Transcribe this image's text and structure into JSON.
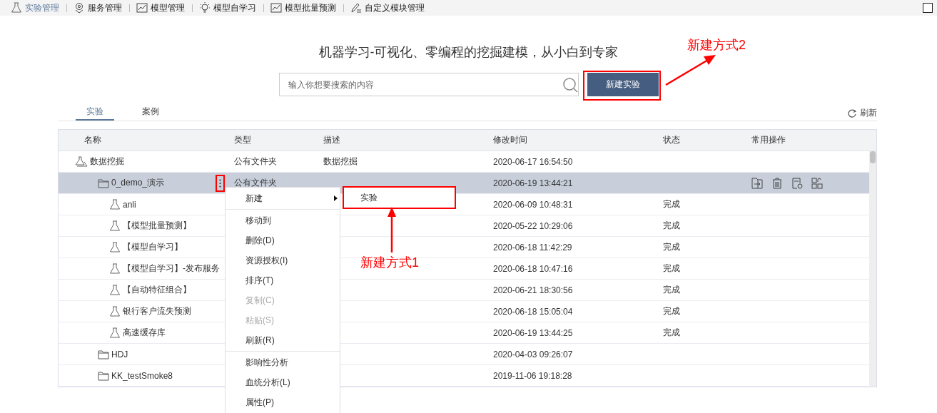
{
  "nav": [
    {
      "label": "实验管理",
      "selected": true
    },
    {
      "label": "服务管理",
      "selected": false
    },
    {
      "label": "模型管理",
      "selected": false
    },
    {
      "label": "模型自学习",
      "selected": false
    },
    {
      "label": "模型批量预测",
      "selected": false
    },
    {
      "label": "自定义模块管理",
      "selected": false
    }
  ],
  "headline": "机器学习-可视化、零编程的挖掘建模，从小白到专家",
  "search": {
    "placeholder": "输入你想要搜索的内容"
  },
  "new_button": "新建实验",
  "tabs": [
    {
      "label": "实验",
      "selected": true
    },
    {
      "label": "案例",
      "selected": false
    }
  ],
  "refresh": "刷新",
  "table": {
    "columns": [
      "名称",
      "类型",
      "描述",
      "修改时间",
      "状态",
      "常用操作"
    ],
    "rows": [
      {
        "kind": "root",
        "name": "数据挖掘",
        "type": "公有文件夹",
        "description": "数据挖掘",
        "modified": "2020-06-17 16:54:50",
        "selected": false,
        "children": [
          {
            "kind": "folder",
            "name": "0_demo_演示",
            "type": "公有文件夹",
            "modified": "2020-06-19 13:44:21",
            "selected": true,
            "children": [
              {
                "kind": "experiment",
                "name": "anli",
                "modified": "2020-06-09 10:48:31",
                "status": "完成",
                "selected": false
              },
              {
                "kind": "experiment",
                "name": "【模型批量预测】",
                "modified": "2020-05-22 10:29:06",
                "status": "完成",
                "selected": false
              },
              {
                "kind": "experiment",
                "name": "【模型自学习】",
                "modified": "2020-06-18 11:42:29",
                "status": "完成",
                "selected": false
              },
              {
                "kind": "experiment",
                "name": "【模型自学习】-发布服务",
                "modified": "2020-06-18 10:47:16",
                "status": "完成",
                "selected": false
              },
              {
                "kind": "experiment",
                "name": "【自动特征组合】",
                "modified": "2020-06-21 18:30:56",
                "status": "完成",
                "selected": false
              },
              {
                "kind": "experiment",
                "name": "银行客户流失预测",
                "modified": "2020-06-18 15:05:04",
                "status": "完成",
                "selected": false
              },
              {
                "kind": "experiment",
                "name": "高速缓存库",
                "modified": "2020-06-19 13:44:25",
                "status": "完成",
                "selected": false
              }
            ]
          },
          {
            "kind": "folder",
            "name": "HDJ",
            "modified": "2020-04-03 09:26:07",
            "selected": false
          },
          {
            "kind": "folder",
            "name": "KK_testSmoke8",
            "modified": "2019-11-06 19:18:28",
            "selected": false
          }
        ]
      }
    ]
  },
  "context_menu": {
    "groups": [
      [
        {
          "label": "新建",
          "disabled": false,
          "submenu": [
            {
              "label": "实验"
            }
          ]
        }
      ],
      [
        {
          "label": "移动到",
          "disabled": false
        },
        {
          "label": "删除(D)",
          "disabled": false
        },
        {
          "label": "资源授权(I)",
          "disabled": false
        },
        {
          "label": "排序(T)",
          "disabled": false
        },
        {
          "label": "复制(C)",
          "disabled": true
        },
        {
          "label": "粘贴(S)",
          "disabled": true
        },
        {
          "label": "刷新(R)",
          "disabled": false
        }
      ],
      [
        {
          "label": "影响性分析",
          "disabled": false
        },
        {
          "label": "血统分析(L)",
          "disabled": false
        },
        {
          "label": "属性(P)",
          "disabled": false
        }
      ]
    ]
  },
  "annotations": [
    {
      "text": "新建方式1"
    },
    {
      "text": "新建方式2"
    }
  ]
}
